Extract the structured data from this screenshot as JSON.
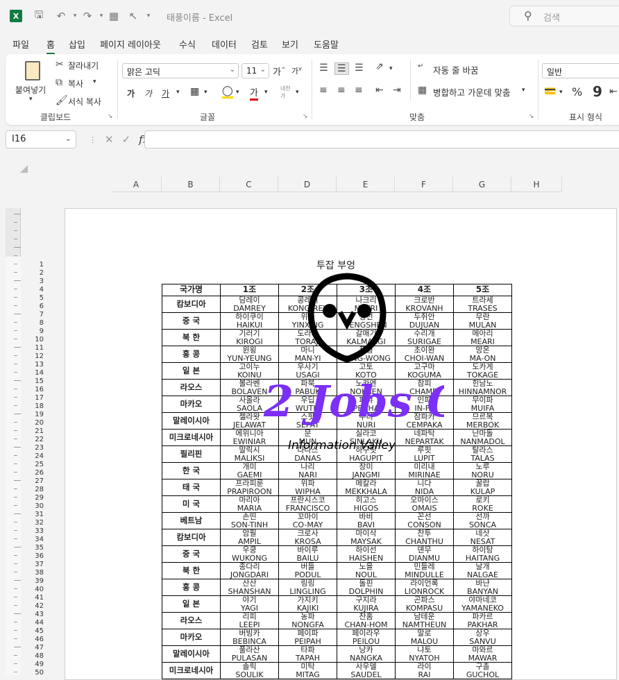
{
  "titlebar": {
    "title": "태풍이름 - Excel",
    "search_placeholder": "검색"
  },
  "tabs": [
    "파일",
    "홈",
    "삽입",
    "페이지 레이아웃",
    "수식",
    "데이터",
    "검토",
    "보기",
    "도움말"
  ],
  "ribbon": {
    "paste": "붙여넣기",
    "cut": "잘라내기",
    "copy": "복사",
    "format_painter": "서식 복사",
    "clipboard_label": "클립보드",
    "font_name": "맑은 고딕",
    "font_size": "11",
    "font_label": "글꼴",
    "wrap_text": "자동 줄 바꿈",
    "merge_center": "병합하고 가운데 맞춤",
    "align_label": "맞춤",
    "number_format": "일반",
    "number_label": "표시 형식"
  },
  "formula_bar": {
    "name_box": "I16",
    "formula": ""
  },
  "columns": [
    "A",
    "B",
    "C",
    "D",
    "E",
    "F",
    "G",
    "H"
  ],
  "row_numbers": [
    "1",
    "2",
    "3",
    "4",
    "5",
    "6",
    "7",
    "8",
    "9",
    "10",
    "11",
    "12",
    "13",
    "14",
    "15",
    "16",
    "17",
    "18",
    "19",
    "20",
    "21",
    "22",
    "23",
    "24",
    "25",
    "26",
    "27",
    "28",
    "29",
    "30",
    "31",
    "32",
    "33",
    "34",
    "35",
    "36",
    "37",
    "38",
    "39",
    "40",
    "41",
    "42",
    "43",
    "44",
    "45",
    "46",
    "47",
    "48",
    "49",
    "50"
  ],
  "sheet": {
    "title": "투잡 부엉",
    "headers": [
      "국가명",
      "1조",
      "2조",
      "3조",
      "4조",
      "5조"
    ],
    "rows": [
      {
        "country": "캄보디아",
        "names": [
          [
            "담레이",
            "DAMREY"
          ],
          [
            "콩레이",
            "KONG-REY"
          ],
          [
            "나크리",
            "NAKRI"
          ],
          [
            "크로반",
            "KROVANH"
          ],
          [
            "트라세",
            "TRASES"
          ]
        ]
      },
      {
        "country": "중 국",
        "names": [
          [
            "하이쿠이",
            "HAIKUI"
          ],
          [
            "위싱",
            "YINXING"
          ],
          [
            "펑선",
            "FENGSHEN"
          ],
          [
            "두쥐안",
            "DUJUAN"
          ],
          [
            "무란",
            "MULAN"
          ]
        ]
      },
      {
        "country": "북 한",
        "names": [
          [
            "기러기",
            "KIROGI"
          ],
          [
            "도라지",
            "TORAJI"
          ],
          [
            "갈매기",
            "KALMAEGI"
          ],
          [
            "수리개",
            "SURIGAE"
          ],
          [
            "메아리",
            "MEARI"
          ]
        ]
      },
      {
        "country": "홍 콩",
        "names": [
          [
            "윈욍",
            "YUN-YEUNG"
          ],
          [
            "마니",
            "MAN-YI"
          ],
          [
            "풍웡",
            "FUNG-WONG"
          ],
          [
            "초이완",
            "CHOI-WAN"
          ],
          [
            "망온",
            "MA-ON"
          ]
        ]
      },
      {
        "country": "일 본",
        "names": [
          [
            "고이누",
            "KOINU"
          ],
          [
            "우사기",
            "USAGI"
          ],
          [
            "고토",
            "KOTO"
          ],
          [
            "고구마",
            "KOGUMA"
          ],
          [
            "도카게",
            "TOKAGE"
          ]
        ]
      },
      {
        "country": "라오스",
        "names": [
          [
            "볼라벤",
            "BOLAVEN"
          ],
          [
            "파북",
            "PABUK"
          ],
          [
            "노카엔",
            "NOKAEN"
          ],
          [
            "참피",
            "CHAMPI"
          ],
          [
            "힌남노",
            "HINNAMNOR"
          ]
        ]
      },
      {
        "country": "마카오",
        "names": [
          [
            "사올라",
            "SAOLA"
          ],
          [
            "우딥",
            "WUTIP"
          ],
          [
            "페냐",
            "PENHA"
          ],
          [
            "인파",
            "IN-FA"
          ],
          [
            "무이파",
            "MUIFA"
          ]
        ]
      },
      {
        "country": "말레이시아",
        "names": [
          [
            "젤라왓",
            "JELAWAT"
          ],
          [
            "스팟",
            "SEPAT"
          ],
          [
            "누리",
            "NURI"
          ],
          [
            "잠파카",
            "CEMPAKA"
          ],
          [
            "므르복",
            "MERBOK"
          ]
        ]
      },
      {
        "country": "미크로네시아",
        "names": [
          [
            "에위니아",
            "EWINIAR"
          ],
          [
            "문",
            "MUN"
          ],
          [
            "실라코",
            "SINLAKU"
          ],
          [
            "네파탁",
            "NEPARTAK"
          ],
          [
            "난마돌",
            "NANMADOL"
          ]
        ]
      },
      {
        "country": "필리핀",
        "names": [
          [
            "말릭시",
            "MALIKSI"
          ],
          [
            "다나스",
            "DANAS"
          ],
          [
            "하구핏",
            "HAGUPIT"
          ],
          [
            "루핏",
            "LUPIT"
          ],
          [
            "탈라스",
            "TALAS"
          ]
        ]
      },
      {
        "country": "한 국",
        "names": [
          [
            "개미",
            "GAEMI"
          ],
          [
            "나리",
            "NARI"
          ],
          [
            "장미",
            "JANGMI"
          ],
          [
            "미리내",
            "MIRINAE"
          ],
          [
            "노루",
            "NORU"
          ]
        ]
      },
      {
        "country": "태 국",
        "names": [
          [
            "프라피룬",
            "PRAPIROON"
          ],
          [
            "위파",
            "WIPHA"
          ],
          [
            "메칼라",
            "MEKKHALA"
          ],
          [
            "니다",
            "NIDA"
          ],
          [
            "꿀랍",
            "KULAP"
          ]
        ]
      },
      {
        "country": "미 국",
        "names": [
          [
            "마리아",
            "MARIA"
          ],
          [
            "프란시스코",
            "FRANCISCO"
          ],
          [
            "히고스",
            "HIGOS"
          ],
          [
            "오마이스",
            "OMAIS"
          ],
          [
            "로키",
            "ROKE"
          ]
        ]
      },
      {
        "country": "베트남",
        "names": [
          [
            "손띤",
            "SON-TINH"
          ],
          [
            "꼬마이",
            "CO-MAY"
          ],
          [
            "바비",
            "BAVI"
          ],
          [
            "꼰선",
            "CONSON"
          ],
          [
            "선까",
            "SONCA"
          ]
        ]
      },
      {
        "country": "캄보디아",
        "names": [
          [
            "암필",
            "AMPIL"
          ],
          [
            "크로사",
            "KROSA"
          ],
          [
            "마이삭",
            "MAYSAK"
          ],
          [
            "찬투",
            "CHANTHU"
          ],
          [
            "네삿",
            "NESAT"
          ]
        ]
      },
      {
        "country": "중 국",
        "names": [
          [
            "우쿵",
            "WUKONG"
          ],
          [
            "바이루",
            "BAILU"
          ],
          [
            "하이선",
            "HAISHEN"
          ],
          [
            "뎬무",
            "DIANMU"
          ],
          [
            "하이탕",
            "HAITANG"
          ]
        ]
      },
      {
        "country": "북 한",
        "names": [
          [
            "종다리",
            "JONGDARI"
          ],
          [
            "버들",
            "PODUL"
          ],
          [
            "노을",
            "NOUL"
          ],
          [
            "민들레",
            "MINDULLE"
          ],
          [
            "날개",
            "NALGAE"
          ]
        ]
      },
      {
        "country": "홍 콩",
        "names": [
          [
            "산산",
            "SHANSHAN"
          ],
          [
            "링링",
            "LINGLING"
          ],
          [
            "돌핀",
            "DOLPHIN"
          ],
          [
            "라이언록",
            "LIONROCK"
          ],
          [
            "바냔",
            "BANYAN"
          ]
        ]
      },
      {
        "country": "일 본",
        "names": [
          [
            "야기",
            "YAGI"
          ],
          [
            "가지키",
            "KAJIKI"
          ],
          [
            "구지라",
            "KUJIRA"
          ],
          [
            "곤파스",
            "KOMPASU"
          ],
          [
            "야마네코",
            "YAMANEKO"
          ]
        ]
      },
      {
        "country": "라오스",
        "names": [
          [
            "리피",
            "LEEPI"
          ],
          [
            "농파",
            "NONGFA"
          ],
          [
            "찬홈",
            "CHAN-HOM"
          ],
          [
            "남테운",
            "NAMTHEUN"
          ],
          [
            "파카르",
            "PAKHAR"
          ]
        ]
      },
      {
        "country": "마카오",
        "names": [
          [
            "버빙카",
            "BEBINCA"
          ],
          [
            "페이파",
            "PEIPAH"
          ],
          [
            "페이라우",
            "PEILOU"
          ],
          [
            "말로",
            "MALOU"
          ],
          [
            "상우",
            "SANVU"
          ]
        ]
      },
      {
        "country": "말레이시아",
        "names": [
          [
            "풀라산",
            "PULASAN"
          ],
          [
            "타파",
            "TAPAH"
          ],
          [
            "낭카",
            "NANGKA"
          ],
          [
            "냐토",
            "NYATOH"
          ],
          [
            "마와르",
            "MAWAR"
          ]
        ]
      },
      {
        "country": "미크로네시아",
        "names": [
          [
            "솔릭",
            "SOULIK"
          ],
          [
            "미탁",
            "MITAG"
          ],
          [
            "사우델",
            "SAUDEL"
          ],
          [
            "라이",
            "RAI"
          ],
          [
            "구촐",
            "GUCHOL"
          ]
        ]
      }
    ]
  },
  "watermark": {
    "brand": "2 Jobs Owl",
    "tagline": "Information Valley"
  }
}
